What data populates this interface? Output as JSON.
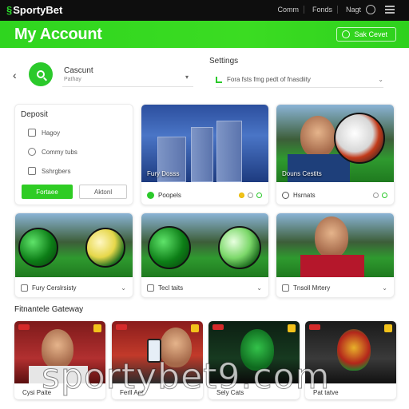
{
  "app": {
    "logo_text": "SportyBet"
  },
  "topnav": {
    "links": [
      "Comm",
      "Fonds",
      "Nagt"
    ]
  },
  "header": {
    "title": "My Account",
    "action_label": "Sak Cevet"
  },
  "account": {
    "name": "Cascunt",
    "sub": "Pathay"
  },
  "settings": {
    "heading": "Settings",
    "row_text": "Fora fsts fmg pedt of fnasdiity"
  },
  "deposit": {
    "heading": "Deposit",
    "items": [
      "Hagoy",
      "Commy tubs",
      "Sshrgbers"
    ],
    "primary_button": "Fortaee",
    "secondary_button": "Aktonl"
  },
  "cards_row1": [
    {
      "overlay": "Fury Dosss",
      "caption": "Poopels"
    },
    {
      "overlay": "Douns Cestits",
      "caption": "Hsrnats"
    }
  ],
  "cards_row2": [
    {
      "caption": "Fury Cerslrsisty"
    },
    {
      "caption": "Tecl taits"
    },
    {
      "caption": "Tnsoll Mrtery"
    }
  ],
  "gateway": {
    "heading": "Fitnantele Gateway",
    "items": [
      "Cysi Paite",
      "Ferll Aot",
      "Sely Cats",
      "Pat tatve"
    ]
  },
  "watermark": "sportybet9.com",
  "colors": {
    "brand_green": "#33d321",
    "topbar": "#0e0e0e",
    "accent_yellow": "#f2c21b"
  }
}
